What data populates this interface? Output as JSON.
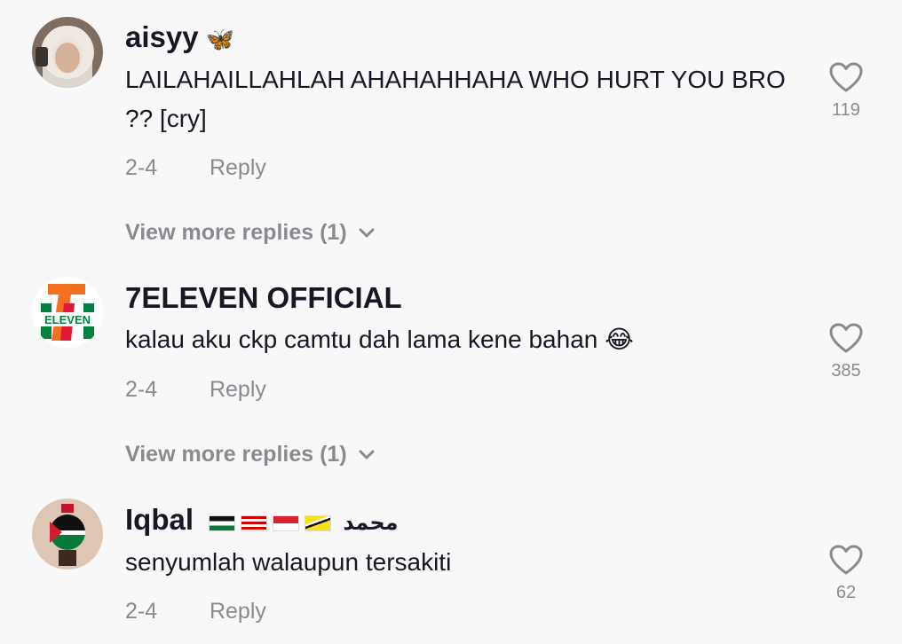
{
  "comments": [
    {
      "username": "aisyy",
      "username_deco": "🦋",
      "text": "LAILAHAILLAHLAH AHAHAHHAHA WHO HURT YOU BRO ?? [cry]",
      "date": "2-4",
      "reply_label": "Reply",
      "likes": "119",
      "more_replies": "View more replies (1)"
    },
    {
      "username": "7ELEVEN OFFICIAL",
      "text": "kalau aku ckp camtu dah lama kene bahan 😂",
      "date": "2-4",
      "reply_label": "Reply",
      "likes": "385",
      "more_replies": "View more replies (1)",
      "avatar_logo_text": "ELEVEN"
    },
    {
      "username": "Iqbal",
      "username_suffix": "محمد",
      "text": "senyumlah walaupun tersakiti",
      "date": "2-4",
      "reply_label": "Reply",
      "likes": "62"
    }
  ],
  "colors": {
    "background": "#f8f8f8",
    "text": "#161823",
    "secondary": "#8a8b91"
  }
}
